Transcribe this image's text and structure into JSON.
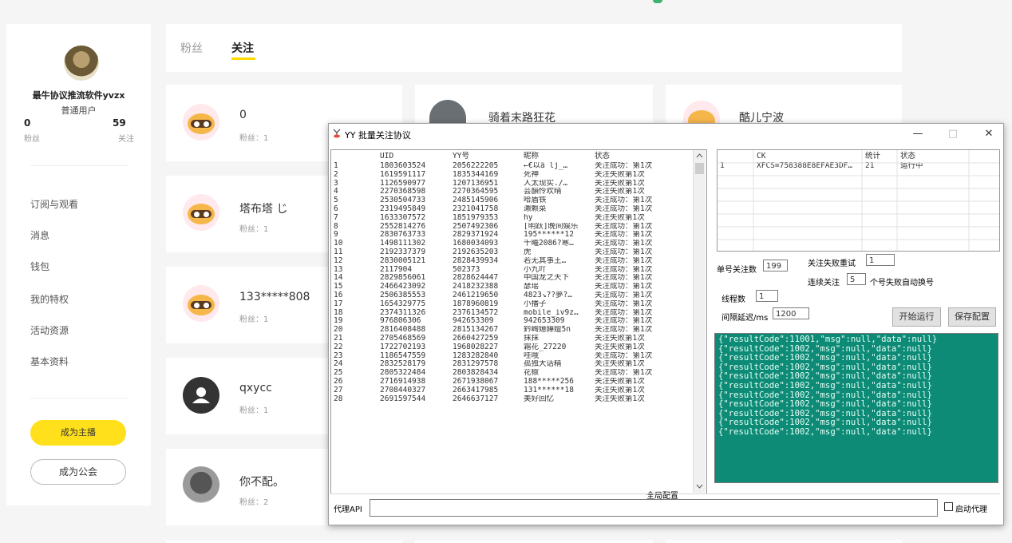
{
  "profile": {
    "name": "最牛协议推流软件yvzx",
    "level": "普通用户",
    "fans_count": "0",
    "fans_label": "粉丝",
    "follow_count": "59",
    "follow_label": "关注"
  },
  "menu": [
    "订阅与观看",
    "消息",
    "钱包",
    "我的特权",
    "活动资源",
    "基本资料"
  ],
  "buttons": {
    "anchor": "成为主播",
    "guild": "成为公会"
  },
  "tabs": {
    "fans": "粉丝",
    "follow": "关注"
  },
  "cards": [
    {
      "name": "0",
      "fans": "粉丝：1"
    },
    {
      "name": "骑着末路狂花",
      "fans": ""
    },
    {
      "name": "酷儿宁波",
      "fans": ""
    },
    {
      "name": "塔布塔 じ",
      "fans": "粉丝：1"
    },
    {
      "name": "133*****808",
      "fans": "粉丝：1"
    },
    {
      "name": "qxycc",
      "fans": "粉丝：1"
    },
    {
      "name": "你不配。",
      "fans": "粉丝：2"
    }
  ],
  "dialog": {
    "title": "YY 批量关注协议",
    "minimize": "—",
    "maximize": "□",
    "close": "✕",
    "table_headers": [
      "",
      "UID",
      "YY号",
      "昵称",
      "状态"
    ],
    "rows": [
      [
        "1",
        "1803603524",
        "2056222205",
        "←€以ä lj_…",
        "关注成功：第1次"
      ],
      [
        "2",
        "1619591117",
        "1835344169",
        "死神",
        "关注失败第1次"
      ],
      [
        "3",
        "1126590977",
        "1207136951",
        "人太现实./…",
        "关注失败第1次"
      ],
      [
        "4",
        "2270368598",
        "2270364595",
        "芸韻怜欢晴",
        "关注失败第1次"
      ],
      [
        "5",
        "2530504733",
        "2485145906",
        "哈盾铁",
        "关注成功：第1次"
      ],
      [
        "6",
        "2319495849",
        "2321041758",
        "濑赖菜",
        "关注成功：第1次"
      ],
      [
        "7",
        "1633307572",
        "1851979353",
        "hy",
        "关注失败第1次"
      ],
      [
        "8",
        "2552814276",
        "2507492306",
        "[明跃]晚间娱乐",
        "关注成功：第1次"
      ],
      [
        "9",
        "2830763733",
        "2829371924",
        "195******12",
        "关注成功：第1次"
      ],
      [
        "10",
        "1498111302",
        "1680034093",
        "千曦2086?寒…",
        "关注成功：第1次"
      ],
      [
        "11",
        "2192337379",
        "2192635203",
        "虎",
        "关注成功：第1次"
      ],
      [
        "12",
        "2830005121",
        "2828439934",
        "若无其事王…",
        "关注成功：第1次"
      ],
      [
        "13",
        "2117904",
        "502373",
        "小九吖",
        "关注成功：第1次"
      ],
      [
        "14",
        "2829856061",
        "2828624447",
        "中国龙之天下",
        "关注成功：第1次"
      ],
      [
        "15",
        "2466423092",
        "2418232388",
        "瑟瑶",
        "关注成功：第1次"
      ],
      [
        "16",
        "2506385553",
        "2461219650",
        "4823↘??夢?…",
        "关注成功：第1次"
      ],
      [
        "17",
        "1654329775",
        "1878960819",
        "小播子",
        "关注成功：第1次"
      ],
      [
        "18",
        "2374311326",
        "2376134572",
        "mobile_iv9z…",
        "关注成功：第1次"
      ],
      [
        "19",
        "976806306",
        "942653309",
        "942653309",
        "关注成功：第1次"
      ],
      [
        "20",
        "2816408488",
        "2815134267",
        "鈐峋嬑嬅嬗5n",
        "关注成功：第1次"
      ],
      [
        "21",
        "2705468569",
        "2660427259",
        "抹抹",
        "关注失败第1次"
      ],
      [
        "22",
        "1722702193",
        "1968028227",
        "霜花_27220",
        "关注失败第1次"
      ],
      [
        "23",
        "1186547559",
        "1283282840",
        "哇哦",
        "关注成功：第1次"
      ],
      [
        "24",
        "2832528179",
        "2831297578",
        "孤独大话精",
        "关注失败第1次"
      ],
      [
        "25",
        "2805322484",
        "2803828434",
        "花椒",
        "关注成功：第1次"
      ],
      [
        "26",
        "2716914938",
        "2671938067",
        "188*****256",
        "关注失败第1次"
      ],
      [
        "27",
        "2708440327",
        "2663417985",
        "131******18",
        "关注失败第1次"
      ],
      [
        "28",
        "2691597544",
        "2646637127",
        "美好回忆",
        "关注失败第1次"
      ]
    ],
    "ck_headers": [
      "",
      "CK",
      "统计",
      "状态"
    ],
    "ck_rows": [
      [
        "1",
        "XFCS=758388E8EFAE3DF…",
        "21",
        "运行中"
      ]
    ],
    "labels": {
      "single_follow": "单号关注数",
      "fail_retry": "关注失败重试",
      "consecutive": "连续关注",
      "auto_switch": "个号失败自动换号",
      "threads": "线程数",
      "interval": "间隔延迟/ms",
      "global_config": "全局配置",
      "proxy_api": "代理API",
      "enable_proxy": "启动代理"
    },
    "values": {
      "single_follow": "199",
      "fail_retry": "1",
      "consecutive": "5",
      "threads": "1",
      "interval": "1200",
      "proxy_api": ""
    },
    "buttons": {
      "start": "开始运行",
      "save": "保存配置"
    },
    "log_lines": [
      "{\"resultCode\":11001,\"msg\":null,\"data\":null}",
      "{\"resultCode\":1002,\"msg\":null,\"data\":null}",
      "{\"resultCode\":1002,\"msg\":null,\"data\":null}",
      "{\"resultCode\":1002,\"msg\":null,\"data\":null}",
      "{\"resultCode\":1002,\"msg\":null,\"data\":null}",
      "{\"resultCode\":1002,\"msg\":null,\"data\":null}",
      "{\"resultCode\":1002,\"msg\":null,\"data\":null}",
      "{\"resultCode\":1002,\"msg\":null,\"data\":null}",
      "{\"resultCode\":1002,\"msg\":null,\"data\":null}",
      "{\"resultCode\":1002,\"msg\":null,\"data\":null}",
      "{\"resultCode\":1002,\"msg\":null,\"data\":null}"
    ]
  },
  "colors": {
    "accent_yellow": "#ffe01b",
    "log_bg": "#0d8b77"
  }
}
